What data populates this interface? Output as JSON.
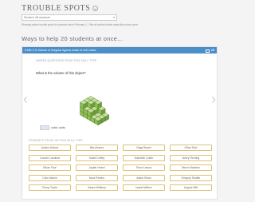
{
  "header": {
    "title": "TROUBLE SPOTS"
  },
  "filter": {
    "student_select_value": "Student: All students"
  },
  "info_text": "Showing active trouble spots for practice since February 1 · See all active trouble spots this school year",
  "section_heading": "Ways to help 20 students at once...",
  "panel": {
    "bar_title": "5.MD.C.5 Volume of irregular figures made of unit cubes",
    "student_count": "20",
    "missed_questions_heading": "MISSED QUESTIONS FROM THIS SKILL TYPE",
    "question": "What is the volume of this object?",
    "answer_unit": "cubic units",
    "students_heading": "STUDENTS STUCK ON THIS SKILL TYPE",
    "students": [
      "Avalon Adams",
      "Mia Alvarez",
      "Gage Beach",
      "Oliver Burt",
      "Conner Cardinal",
      "Kaleb Coffey",
      "Gabrielle Cotter",
      "Avery Fleming",
      "Ethan Frye",
      "Jaylah Heard",
      "Fiona Larson",
      "Tatum Mcarthur",
      "Colin Maxim",
      "Nora Pelkins",
      "Adam Rowe",
      "Gregory Shaffer",
      "Romy Towle",
      "Kasen Whitney",
      "Isabel Willem",
      "August Witt"
    ]
  },
  "colors": {
    "accent": "#4a8fc9",
    "cube_top": "#c7df9c",
    "cube_front": "#8fbe55",
    "cube_side": "#6f9e3d",
    "chip_border": "#d9c27a"
  },
  "icons": {
    "title_icon": "smile-icon",
    "share": "share-icon",
    "prev": "chevron-left-icon",
    "next": "chevron-right-icon"
  }
}
